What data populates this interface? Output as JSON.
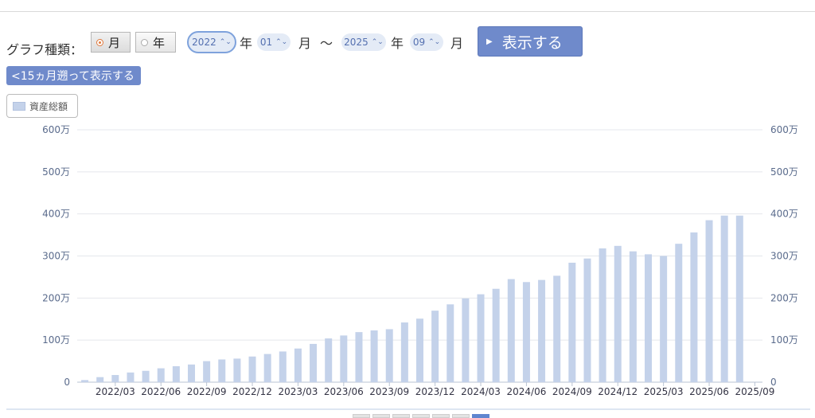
{
  "controls": {
    "graph_type_label": "グラフ種類：",
    "type_month": "月",
    "type_year": "年",
    "start_year": "2022",
    "year_unit_1": "年",
    "start_month": "01",
    "month_unit_1": "月",
    "range_sep": "〜",
    "end_year": "2025",
    "year_unit_2": "年",
    "end_month": "09",
    "month_unit_2": "月",
    "show_button": "表示する",
    "back_button": "<15ヵ月遡って表示する"
  },
  "colors": {
    "bar_fill": "#c4d2ea",
    "button": "#6f8acb",
    "axis_text": "#5a6b8c"
  },
  "chart_data": {
    "type": "bar",
    "legend": [
      "資産総額"
    ],
    "legend_placement": "top-left",
    "grid": true,
    "y_ticks": [
      0,
      1000000,
      2000000,
      3000000,
      4000000,
      5000000,
      6000000
    ],
    "y_tick_labels": [
      "0",
      "100万",
      "200万",
      "300万",
      "400万",
      "500万",
      "600万"
    ],
    "ylim": [
      0,
      6000000
    ],
    "x_tick_labels": [
      "2022/03",
      "2022/06",
      "2022/09",
      "2022/12",
      "2023/03",
      "2023/06",
      "2023/09",
      "2023/12",
      "2024/03",
      "2024/06",
      "2024/09",
      "2024/12",
      "2025/03",
      "2025/06",
      "2025/09"
    ],
    "categories": [
      "2022/01",
      "2022/02",
      "2022/03",
      "2022/04",
      "2022/05",
      "2022/06",
      "2022/07",
      "2022/08",
      "2022/09",
      "2022/10",
      "2022/11",
      "2022/12",
      "2023/01",
      "2023/02",
      "2023/03",
      "2023/04",
      "2023/05",
      "2023/06",
      "2023/07",
      "2023/08",
      "2023/09",
      "2023/10",
      "2023/11",
      "2023/12",
      "2024/01",
      "2024/02",
      "2024/03",
      "2024/04",
      "2024/05",
      "2024/06",
      "2024/07",
      "2024/08",
      "2024/09",
      "2024/10",
      "2024/11",
      "2024/12",
      "2025/01",
      "2025/02",
      "2025/03",
      "2025/04",
      "2025/05",
      "2025/06",
      "2025/07",
      "2025/08",
      "2025/09"
    ],
    "series": [
      {
        "name": "資産総額",
        "values": [
          50000,
          120000,
          170000,
          230000,
          270000,
          330000,
          380000,
          420000,
          500000,
          540000,
          560000,
          610000,
          670000,
          730000,
          800000,
          910000,
          1040000,
          1110000,
          1190000,
          1230000,
          1260000,
          1420000,
          1510000,
          1700000,
          1850000,
          1990000,
          2090000,
          2220000,
          2450000,
          2380000,
          2430000,
          2530000,
          2840000,
          2940000,
          3180000,
          3240000,
          3110000,
          3040000,
          3000000,
          3290000,
          3560000,
          3850000,
          3960000,
          3960000
        ]
      }
    ]
  }
}
